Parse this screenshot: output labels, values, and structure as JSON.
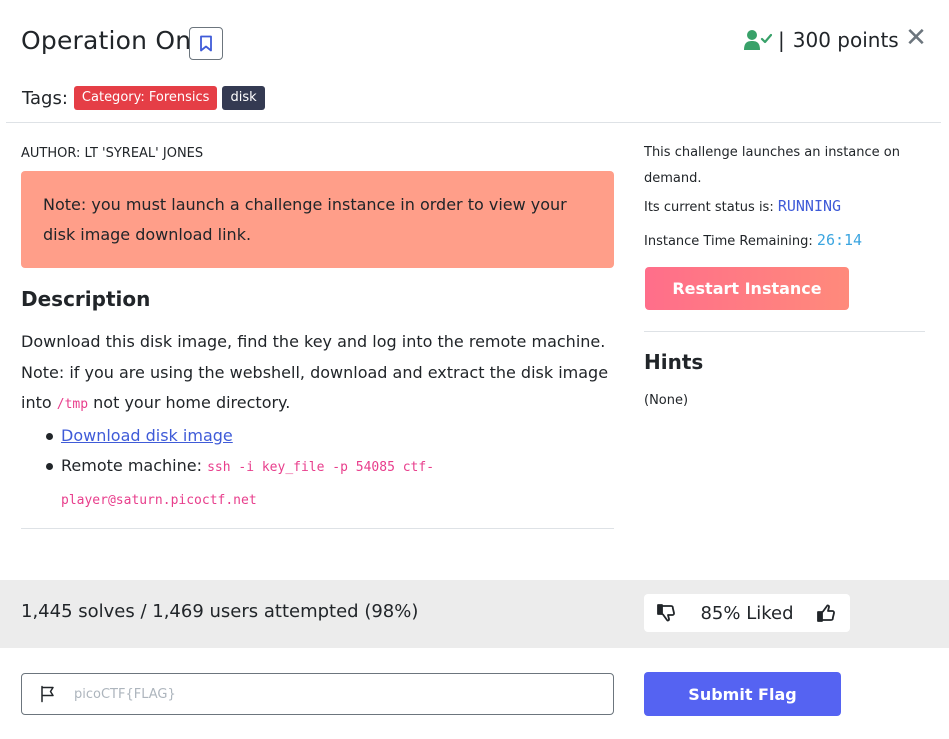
{
  "header": {
    "title": "Operation Oni",
    "points_sep": "|",
    "points_text": "300 points",
    "close_glyph": "✕",
    "tags_label": "Tags:",
    "tags": [
      "Category: Forensics",
      "disk"
    ]
  },
  "colors": {
    "tag_category": "#e53e46",
    "tag_disk": "#343a52",
    "note_bg": "#ff9e89",
    "restart_btn": "#ff7a82",
    "submit_btn": "#5563f2",
    "status_running": "#3f5bd8",
    "time_remaining": "#3ba5e0",
    "solved_icon": "#38a169"
  },
  "main": {
    "author": "AUTHOR: LT 'SYREAL' JONES",
    "note": "Note: you must launch a challenge instance in order to view your disk image download link.",
    "description_title": "Description",
    "desc_line1": "Download this disk image, find the key and log into the remote machine.",
    "desc_line2_prefix": "Note: if you are using the webshell, download and extract the disk image into",
    "desc_tmp": "/tmp",
    "desc_line2_suffix": " not your home directory.",
    "download_link": "Download disk image",
    "remote_label": "Remote machine: ",
    "remote_cmd": "ssh -i key_file -p 54085 ctf-player@saturn.picoctf.net"
  },
  "sidebar": {
    "launch_text": "This challenge launches an instance on demand.",
    "status_label": "Its current status is: ",
    "status_value": "RUNNING",
    "time_label": "Instance Time Remaining: ",
    "time_value": "26:14",
    "restart_label": "Restart Instance",
    "hints_title": "Hints",
    "hints_value": "(None)"
  },
  "stats": {
    "solves_text": "1,445 solves / 1,469 users attempted (98%)",
    "liked_text": "85% Liked"
  },
  "flag": {
    "placeholder": "picoCTF{FLAG}",
    "value": "",
    "submit_label": "Submit Flag"
  },
  "icons": [
    "bookmark-icon",
    "user-check-icon",
    "close-icon",
    "thumbs-down-icon",
    "thumbs-up-icon",
    "flag-icon"
  ]
}
